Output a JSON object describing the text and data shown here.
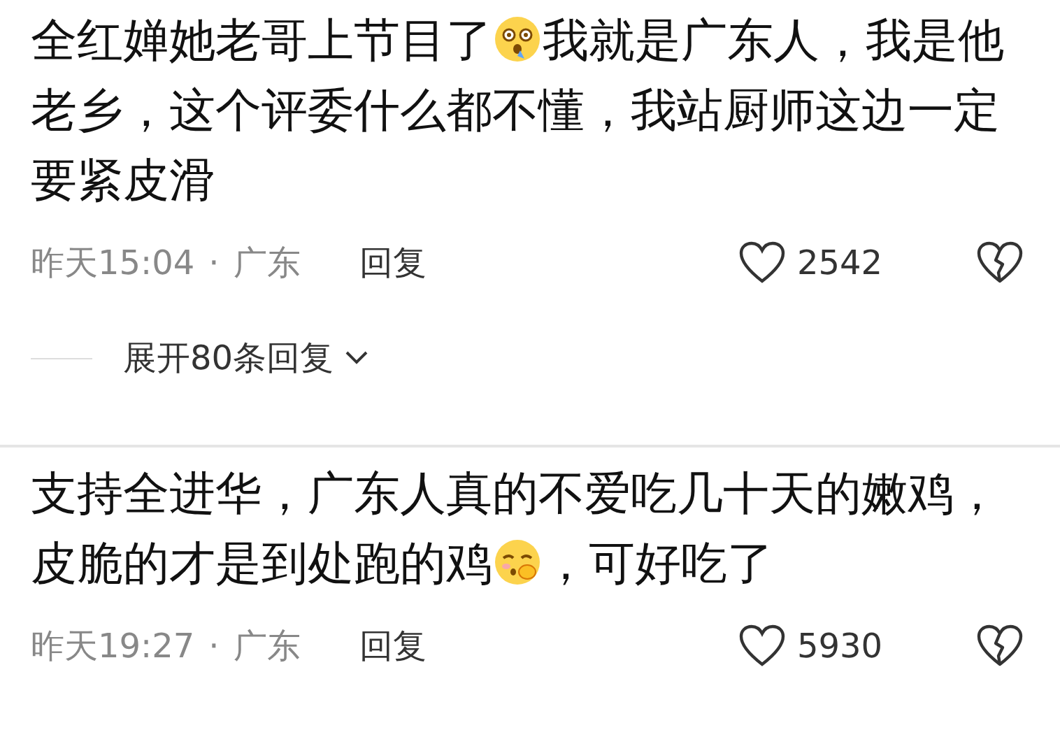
{
  "comments": [
    {
      "segments": [
        {
          "kind": "text",
          "text": "全红婵她老哥上节目了"
        },
        {
          "kind": "emoji"
        },
        {
          "kind": "text",
          "text": "我就是广东人，我是他老乡，这个评委什么都不懂，我站厨师这边一定要紧皮滑"
        }
      ],
      "time": "昨天15:04",
      "separator": "·",
      "location": "广东",
      "reply": "回复",
      "likes": "2542",
      "expand": "展开80条回复"
    },
    {
      "segments": [
        {
          "kind": "text",
          "text": "支持全进华，广东人真的不爱吃几十天的嫩鸡，皮脆的才是到处跑的鸡"
        },
        {
          "kind": "emoji2"
        },
        {
          "kind": "text",
          "text": "，可好吃了"
        }
      ],
      "time": "昨天19:27",
      "separator": "·",
      "location": "广东",
      "reply": "回复",
      "likes": "5930"
    }
  ]
}
